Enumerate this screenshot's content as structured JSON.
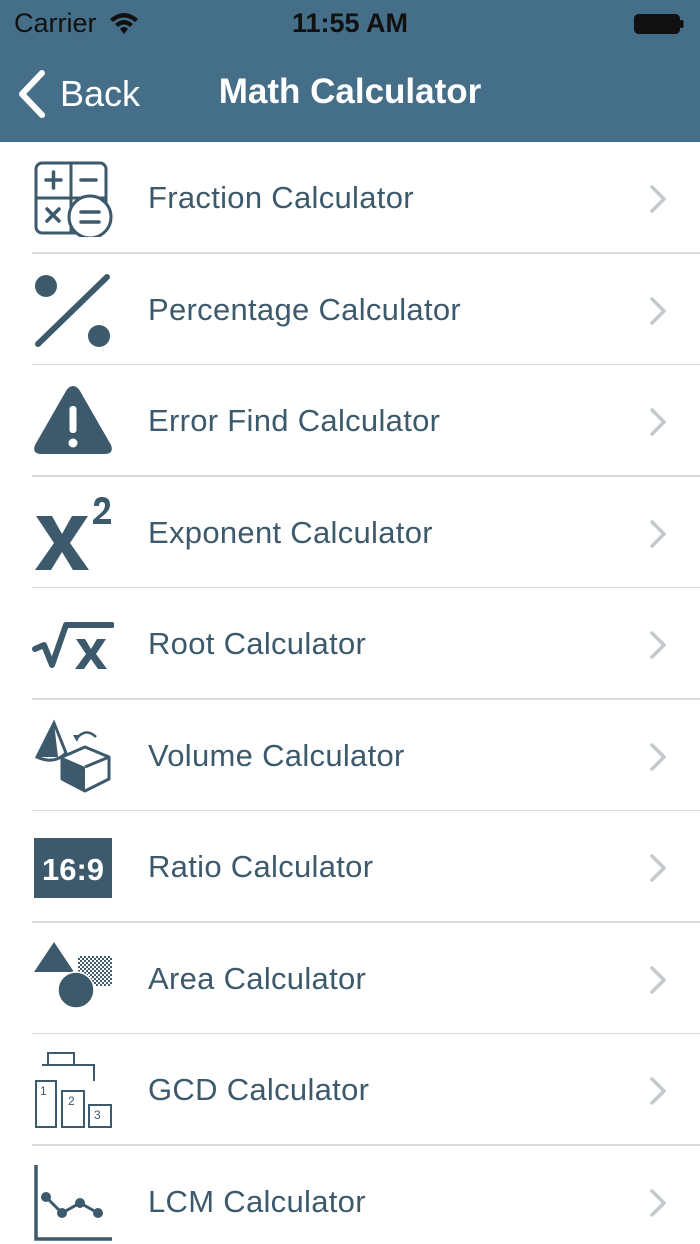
{
  "status_bar": {
    "carrier": "Carrier",
    "time": "11:55 AM"
  },
  "nav": {
    "back_label": "Back",
    "title": "Math Calculator"
  },
  "colors": {
    "header": "#456f89",
    "icon": "#3d5a6d",
    "text": "#3d5a6d",
    "chevron": "#c4c9cc",
    "separator": "#d6dadd"
  },
  "items": [
    {
      "label": "Fraction Calculator",
      "icon": "fraction-icon"
    },
    {
      "label": "Percentage Calculator",
      "icon": "percentage-icon"
    },
    {
      "label": "Error Find Calculator",
      "icon": "warning-icon"
    },
    {
      "label": "Exponent Calculator",
      "icon": "exponent-icon"
    },
    {
      "label": "Root Calculator",
      "icon": "square-root-icon"
    },
    {
      "label": "Volume Calculator",
      "icon": "cube-cone-icon"
    },
    {
      "label": "Ratio Calculator",
      "icon": "ratio-icon",
      "icon_text": "16:9"
    },
    {
      "label": "Area Calculator",
      "icon": "shapes-icon"
    },
    {
      "label": "GCD Calculator",
      "icon": "podium-icon",
      "icon_text": [
        "1",
        "2",
        "3"
      ]
    },
    {
      "label": "LCM Calculator",
      "icon": "line-graph-icon"
    }
  ]
}
